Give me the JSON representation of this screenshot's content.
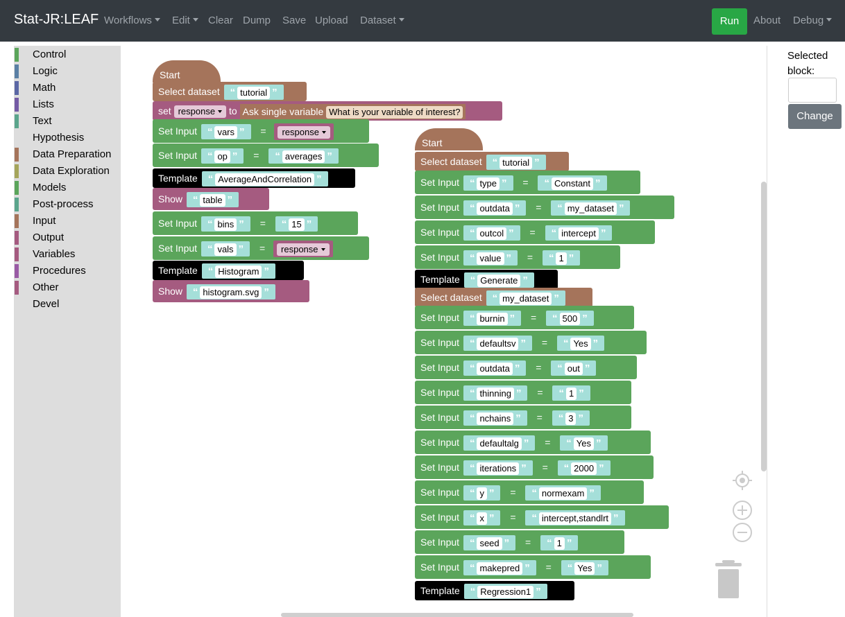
{
  "navbar": {
    "brand": "Stat-JR:LEAF",
    "items": [
      {
        "label": "Workflows",
        "dropdown": true
      },
      {
        "label": "Edit",
        "dropdown": true
      },
      {
        "label": "Clear",
        "dropdown": false
      },
      {
        "label": "Dump",
        "dropdown": false
      },
      {
        "label": "Save",
        "dropdown": false
      },
      {
        "label": "Upload",
        "dropdown": false
      },
      {
        "label": "Dataset",
        "dropdown": true
      }
    ],
    "run": "Run",
    "about": "About",
    "debug": "Debug"
  },
  "toolbox": [
    {
      "label": "Control",
      "color": "#5ba55b"
    },
    {
      "label": "Logic",
      "color": "#5b80a5"
    },
    {
      "label": "Math",
      "color": "#5b67a5"
    },
    {
      "label": "Lists",
      "color": "#745ba5"
    },
    {
      "label": "Text",
      "color": "#5ba58c"
    },
    {
      "label": "Hypothesis",
      "color": ""
    },
    {
      "label": "Data Preparation",
      "color": "#a5745b"
    },
    {
      "label": "Data Exploration",
      "color": "#a5a55b"
    },
    {
      "label": "Models",
      "color": "#5ba55b"
    },
    {
      "label": "Post-process",
      "color": "#5ba58c"
    },
    {
      "label": "Input",
      "color": "#a5745b"
    },
    {
      "label": "Output",
      "color": "#a55b80"
    },
    {
      "label": "Variables",
      "color": "#a55b80"
    },
    {
      "label": "Procedures",
      "color": "#995ba5"
    },
    {
      "label": "Other",
      "color": "#a55b80"
    },
    {
      "label": "Devel",
      "color": ""
    }
  ],
  "workspace": {
    "stack1": {
      "start": "Start",
      "select_dataset_label": "Select dataset",
      "select_dataset_value": "tutorial",
      "set_label": "set",
      "set_var": "response",
      "set_to": "to",
      "ask_label": "Ask single variable",
      "ask_prompt": "What is your variable of interest?",
      "setinput_label": "Set Input",
      "eq": "=",
      "si1_key": "vars",
      "si1_var": "response",
      "si2_key": "op",
      "si2_val": "averages",
      "template_label": "Template",
      "tpl1": "AverageAndCorrelation",
      "show_label": "Show",
      "show1": "table",
      "si3_key": "bins",
      "si3_val": "15",
      "si4_key": "vals",
      "si4_var": "response",
      "tpl2": "Histogram",
      "show2": "histogram.svg"
    },
    "stack2": {
      "start": "Start",
      "select_dataset_label": "Select dataset",
      "select_dataset_value": "tutorial",
      "setinput_label": "Set Input",
      "eq": "=",
      "template_label": "Template",
      "inputs_a": [
        {
          "key": "type",
          "value": "Constant"
        },
        {
          "key": "outdata",
          "value": "my_dataset"
        },
        {
          "key": "outcol",
          "value": "intercept"
        },
        {
          "key": "value",
          "value": "1"
        }
      ],
      "tpl1": "Generate",
      "select_dataset_value2": "my_dataset",
      "inputs_b": [
        {
          "key": "burnin",
          "value": "500"
        },
        {
          "key": "defaultsv",
          "value": "Yes"
        },
        {
          "key": "outdata",
          "value": "out"
        },
        {
          "key": "thinning",
          "value": "1"
        },
        {
          "key": "nchains",
          "value": "3"
        },
        {
          "key": "defaultalg",
          "value": "Yes"
        },
        {
          "key": "iterations",
          "value": "2000"
        },
        {
          "key": "y",
          "value": "normexam"
        },
        {
          "key": "x",
          "value": "intercept,standlrt"
        },
        {
          "key": "seed",
          "value": "1"
        },
        {
          "key": "makepred",
          "value": "Yes"
        }
      ],
      "tpl2": "Regression1"
    }
  },
  "sidepanel": {
    "selected_label": "Selected block:",
    "change": "Change"
  }
}
